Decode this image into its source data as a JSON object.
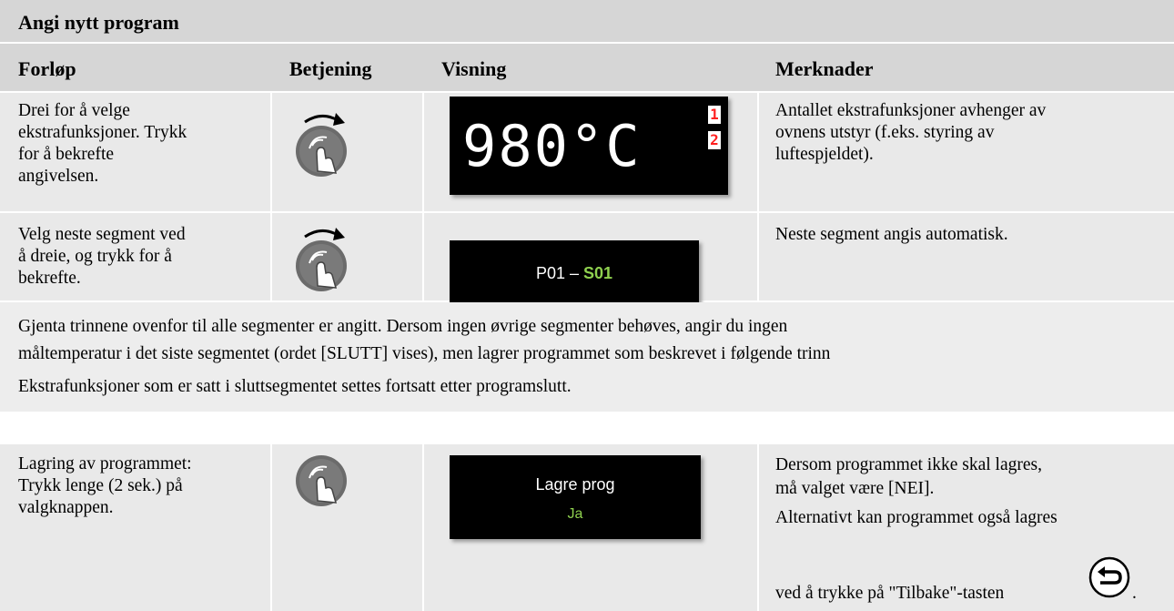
{
  "title": "Angi nytt program",
  "columns": [
    "Forløp",
    "Betjening",
    "Visning",
    "Merknader"
  ],
  "rows": [
    {
      "forlop": [
        "Drei for å velge",
        "ekstrafunksjoner. Trykk",
        "for å bekrefte",
        "angivelsen."
      ],
      "display": {
        "value": "980°C",
        "flags": [
          "1",
          "2"
        ]
      },
      "merknader": [
        "Antallet ekstrafunksjoner avhenger av",
        "ovnens utstyr (f.eks. styring av",
        "luftespjeldet)."
      ]
    },
    {
      "forlop": [
        "Velg neste segment ved",
        "å dreie, og trykk for å",
        "bekrefte."
      ],
      "display": {
        "prefix": "P01 – ",
        "segment": "S01"
      },
      "merknader": [
        "Neste segment angis automatisk."
      ]
    }
  ],
  "note": {
    "line1": "Gjenta trinnene ovenfor til alle segmenter er angitt. Dersom ingen øvrige segmenter behøves, angir du ingen",
    "line2": "måltemperatur i det siste segmentet (ordet [SLUTT] vises), men lagrer programmet som beskrevet i følgende trinn",
    "line3": "Ekstrafunksjoner som er satt i sluttsegmentet settes fortsatt etter programslutt."
  },
  "save_row": {
    "forlop": [
      "Lagring av programmet:",
      "Trykk lenge (2 sek.) på",
      "valgknappen."
    ],
    "display": {
      "line1": "Lagre prog",
      "line2": "Ja"
    },
    "merknader": [
      "Dersom programmet ikke skal lagres,",
      "må valget være [NEI].",
      "Alternativt kan programmet også lagres",
      "ved å trykke på \"Tilbake\"-tasten",
      "."
    ]
  },
  "colors": {
    "header_bg": "#d6d6d6",
    "cell_bg": "#e9e9e9",
    "accent_green": "#8fd14f",
    "seg_red": "#ff2020"
  },
  "icons": [
    "rotary-knob-icon",
    "press-knob-icon",
    "back-key-icon"
  ]
}
